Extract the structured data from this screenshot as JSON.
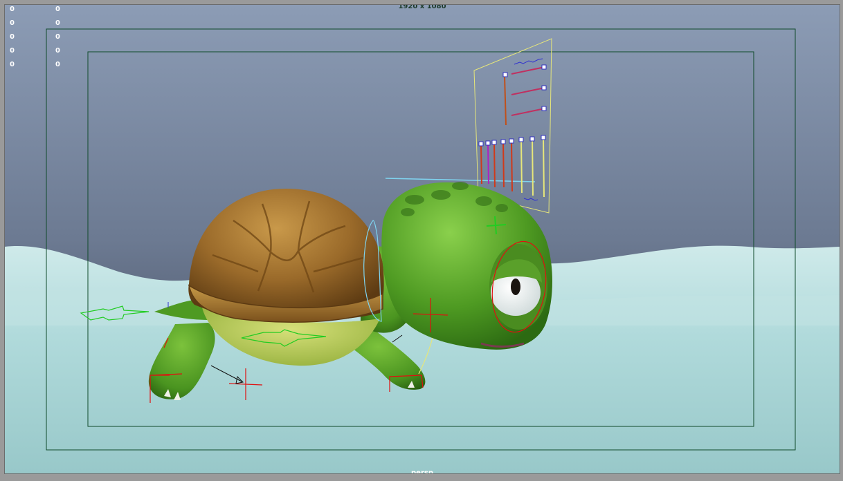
{
  "viewport": {
    "resolution_label": "1920 x 1080",
    "camera_label": "persp"
  },
  "hud": {
    "left_column": [
      "0",
      "0",
      "0",
      "0",
      "0"
    ],
    "right_column": [
      "0",
      "0",
      "0",
      "0",
      "0"
    ]
  },
  "colors": {
    "sky_top": "#8b9ab2",
    "sky_bottom": "#3e4454",
    "ground": "#a6d3d4",
    "safe_frame": "#0f4a2a",
    "turtle_skin": "#5aa02a",
    "shell": "#9a6a2a",
    "control_red": "#e01010",
    "control_green": "#22cc22",
    "control_yellow": "#e6e67a",
    "control_cyan": "#7fd4f0"
  }
}
